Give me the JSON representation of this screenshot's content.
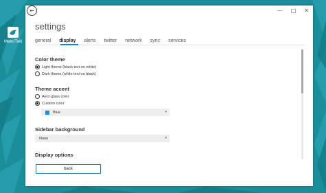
{
  "desktop": {
    "background_color": "#1b8e9c",
    "icon": {
      "label": "MetroTwit",
      "icon_name": "metrotwit-bird-icon"
    }
  },
  "window": {
    "back_icon": "back-arrow-icon",
    "controls": {
      "minimize": "—",
      "maximize": "□",
      "close": "✕"
    },
    "title": "settings",
    "tabs": [
      {
        "label": "general",
        "active": false
      },
      {
        "label": "display",
        "active": true
      },
      {
        "label": "alerts",
        "active": false
      },
      {
        "label": "twitter",
        "active": false
      },
      {
        "label": "network",
        "active": false
      },
      {
        "label": "sync",
        "active": false
      },
      {
        "label": "services",
        "active": false
      }
    ],
    "accent_color": "#1a8aa0"
  },
  "color_theme": {
    "heading": "Color theme",
    "options": [
      {
        "label": "Light theme (black text on white)",
        "checked": true
      },
      {
        "label": "Dark theme (white text on black)",
        "checked": false
      }
    ]
  },
  "theme_accent": {
    "heading": "Theme accent",
    "options": [
      {
        "label": "Aero glass color",
        "checked": false
      },
      {
        "label": "Custom color",
        "checked": true
      }
    ],
    "color_select": {
      "value": "Blue",
      "swatch_color": "#1a8ed0"
    }
  },
  "sidebar_background": {
    "heading": "Sidebar background",
    "select": {
      "value": "None"
    }
  },
  "display_options": {
    "heading": "Display options"
  },
  "footer": {
    "back_label": "back"
  }
}
